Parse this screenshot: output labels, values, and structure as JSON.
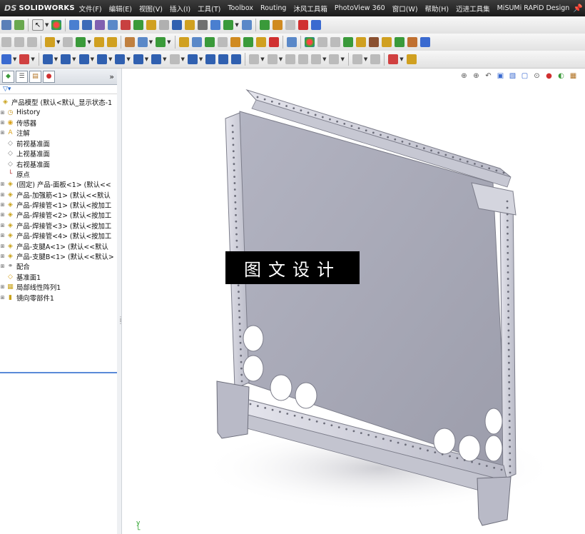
{
  "app": {
    "logo_prefix": "DS",
    "logo_text": "SOLIDWORKS"
  },
  "menu": [
    "文件(F)",
    "编辑(E)",
    "视图(V)",
    "插入(I)",
    "工具(T)",
    "Toolbox",
    "Routing",
    "沐风工具箱",
    "PhotoView 360",
    "窗口(W)",
    "帮助(H)",
    "迈进工具集",
    "MiSUMi RAPiD Design"
  ],
  "tree": {
    "root": "产品模型 (默认<默认_显示状态-1",
    "items": [
      {
        "label": "History",
        "icon": "history-icon",
        "color": "#c89a2a"
      },
      {
        "label": "传感器",
        "icon": "sensor-icon",
        "color": "#d9a21b"
      },
      {
        "label": "注解",
        "icon": "annotation-icon",
        "color": "#d9a21b"
      },
      {
        "label": "前视基准面",
        "icon": "plane-icon",
        "color": "#808080"
      },
      {
        "label": "上视基准面",
        "icon": "plane-icon",
        "color": "#808080"
      },
      {
        "label": "右视基准面",
        "icon": "plane-icon",
        "color": "#808080"
      },
      {
        "label": "原点",
        "icon": "origin-icon",
        "color": "#b03030"
      },
      {
        "label": "(固定) 产品-面板<1> (默认<<",
        "icon": "part-icon",
        "color": "#c9a21a"
      },
      {
        "label": "产品-加强筋<1> (默认<<默认",
        "icon": "part-icon",
        "color": "#c9a21a"
      },
      {
        "label": "产品-焊接管<1> (默认<按加工",
        "icon": "part-icon",
        "color": "#c9a21a"
      },
      {
        "label": "产品-焊接管<2> (默认<按加工",
        "icon": "part-icon",
        "color": "#c9a21a"
      },
      {
        "label": "产品-焊接管<3> (默认<按加工",
        "icon": "part-icon",
        "color": "#c9a21a"
      },
      {
        "label": "产品-焊接管<4> (默认<按加工",
        "icon": "part-icon",
        "color": "#c9a21a"
      },
      {
        "label": "产品-支腿A<1> (默认<<默认",
        "icon": "part-icon",
        "color": "#c9a21a"
      },
      {
        "label": "产品-支腿B<1> (默认<<默认>",
        "icon": "part-icon",
        "color": "#c9a21a"
      },
      {
        "label": "配合",
        "icon": "mates-icon",
        "color": "#707070"
      },
      {
        "label": "基准面1",
        "icon": "plane-icon",
        "color": "#d9a21b"
      },
      {
        "label": "局部线性阵列1",
        "icon": "pattern-icon",
        "color": "#c9a21a"
      },
      {
        "label": "镜向零部件1",
        "icon": "mirror-icon",
        "color": "#c9a21a"
      }
    ]
  },
  "viewport": {
    "watermark": "图文设计"
  },
  "colors": {
    "panel": "#a9aab7",
    "frame": "#d8d8e2",
    "frame_dark": "#8d8e9c",
    "hole": "#ffffff"
  }
}
